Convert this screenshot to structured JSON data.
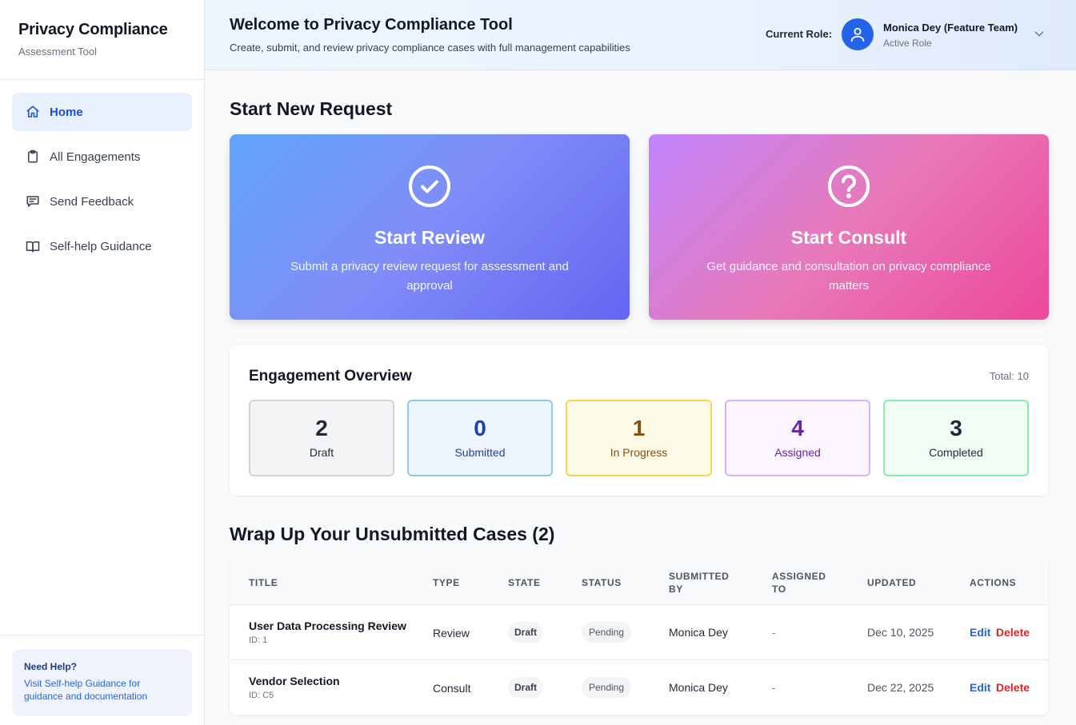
{
  "sidebar": {
    "brand_title": "Privacy Compliance",
    "brand_subtitle": "Assessment Tool",
    "items": [
      {
        "label": "Home",
        "icon": "home-icon",
        "active": true
      },
      {
        "label": "All Engagements",
        "icon": "clipboard-icon"
      },
      {
        "label": "Send Feedback",
        "icon": "message-icon"
      },
      {
        "label": "Self-help Guidance",
        "icon": "book-icon"
      }
    ],
    "help": {
      "title": "Need Help?",
      "text": "Visit Self-help Guidance for guidance and documentation"
    }
  },
  "header": {
    "title": "Welcome to Privacy Compliance Tool",
    "subtitle": "Create, submit, and review privacy compliance cases with full management capabilities",
    "role_label": "Current Role:",
    "user_name": "Monica Dey (Feature Team)",
    "user_role": "Active Role"
  },
  "start_request": {
    "title": "Start New Request",
    "review": {
      "title": "Start Review",
      "description": "Submit a privacy review request for assessment and approval",
      "icon": "check-circle-icon"
    },
    "consult": {
      "title": "Start Consult",
      "description": "Get guidance and consultation on privacy compliance matters",
      "icon": "question-circle-icon"
    }
  },
  "overview": {
    "title": "Engagement Overview",
    "total": "Total: 10",
    "stats": [
      {
        "value": "2",
        "label": "Draft",
        "color": "#1f2937",
        "border": "#d1d5db",
        "bg": "#f3f4f6"
      },
      {
        "value": "0",
        "label": "Submitted",
        "color": "#1e40af",
        "border": "#93c5fd",
        "bg": "#eff6ff"
      },
      {
        "value": "1",
        "label": "In Progress",
        "color": "#854d0e",
        "border": "#fcd34d",
        "bg": "#fefce8"
      },
      {
        "value": "4",
        "label": "Assigned",
        "color": "#6b21a8",
        "border": "#d8b4fe",
        "bg": "#faf5ff"
      },
      {
        "value": "3",
        "label": "Completed",
        "color": "#1f2937",
        "border": "#86efac",
        "bg": "#f0fdf4"
      }
    ]
  },
  "unsubmitted": {
    "title": "Wrap Up Your Unsubmitted Cases (2)",
    "columns": [
      "TITLE",
      "TYPE",
      "STATE",
      "STATUS",
      "SUBMITTED BY",
      "ASSIGNED TO",
      "UPDATED",
      "ACTIONS"
    ],
    "rows": [
      {
        "title": "User Data Processing Review",
        "id": "ID: 1",
        "type": "Review",
        "state": "Draft",
        "status": "Pending",
        "submitted_by": "Monica Dey",
        "assigned_to": "-",
        "updated": "Dec 10, 2025",
        "edit": "Edit",
        "delete": "Delete"
      },
      {
        "title": "Vendor Selection",
        "id": "ID: C5",
        "type": "Consult",
        "state": "Draft",
        "status": "Pending",
        "submitted_by": "Monica Dey",
        "assigned_to": "-",
        "updated": "Dec 22, 2025",
        "edit": "Edit",
        "delete": "Delete"
      }
    ]
  }
}
